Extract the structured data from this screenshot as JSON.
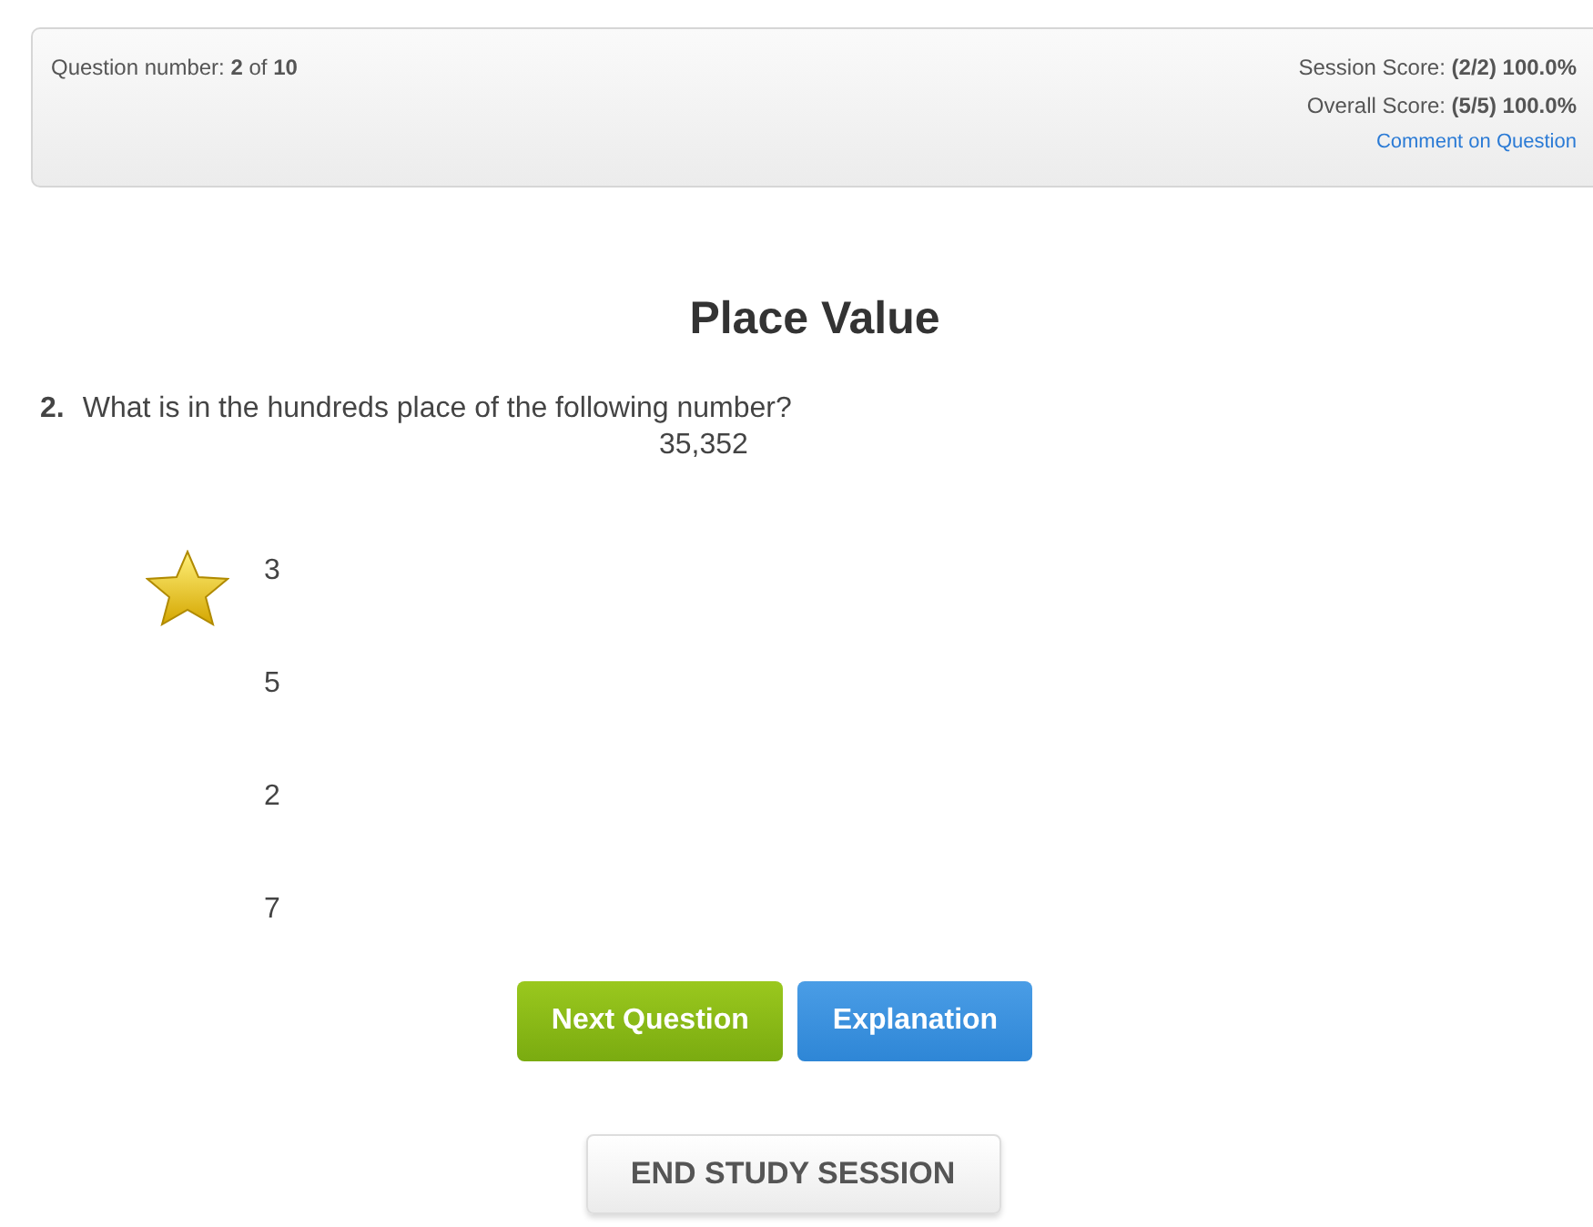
{
  "header": {
    "question_number": "Question number: **2** of **10**",
    "session_score": "Session Score: **(2/2) 100.0%**",
    "overall_score": "Overall Score: **(5/5) 100.0%**",
    "comment_link": "Comment on Question"
  },
  "title": "Place Value",
  "question": {
    "number": "2.",
    "text": "What is in the hundreds place of the following number?",
    "value": "35,352"
  },
  "answers": [
    {
      "text": "3",
      "starred": true
    },
    {
      "text": "5",
      "starred": false
    },
    {
      "text": "2",
      "starred": false
    },
    {
      "text": "7",
      "starred": false
    }
  ],
  "buttons": [
    {
      "kind": "next",
      "label": "Next Question"
    },
    {
      "kind": "explain",
      "label": "Explanation"
    }
  ],
  "end_button": "END STUDY SESSION"
}
